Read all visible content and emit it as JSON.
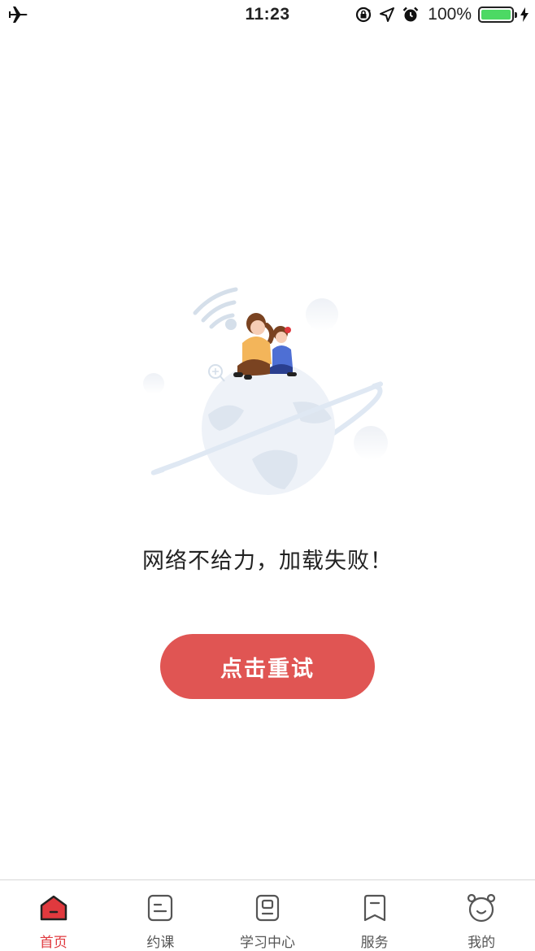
{
  "status_bar": {
    "time": "11:23",
    "battery_percent": "100%",
    "icons": [
      "airplane-icon",
      "rotation-lock-icon",
      "location-icon",
      "alarm-icon",
      "battery-icon",
      "charging-icon"
    ]
  },
  "main": {
    "illustration": "network-error-illustration",
    "message": "网络不给力，加载失败！",
    "retry_label": "点击重试"
  },
  "tab_bar": {
    "items": [
      {
        "label": "首页",
        "icon": "home-icon",
        "active": true
      },
      {
        "label": "约课",
        "icon": "booking-icon",
        "active": false
      },
      {
        "label": "学习中心",
        "icon": "learning-center-icon",
        "active": false
      },
      {
        "label": "服务",
        "icon": "service-icon",
        "active": false
      },
      {
        "label": "我的",
        "icon": "profile-icon",
        "active": false
      }
    ]
  },
  "colors": {
    "accent": "#e05553",
    "active_tab": "#e0393e",
    "battery": "#4cd964"
  }
}
